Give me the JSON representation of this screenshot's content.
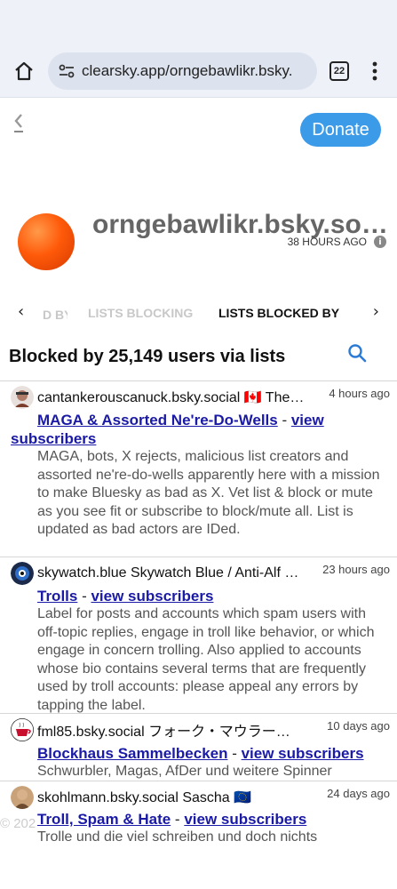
{
  "browser": {
    "url": "clearsky.app/orngebawlikr.bsky.",
    "tab_count": "22"
  },
  "header": {
    "donate_label": "Donate"
  },
  "profile": {
    "handle": "orngebawlikr.bsky.social",
    "joined": "38 HOURS AGO"
  },
  "tabs": {
    "partial_left": "D BY",
    "blocking": "LISTS BLOCKING",
    "blocked_by": "LISTS BLOCKED BY"
  },
  "section": {
    "title": "Blocked by 25,149 users via lists"
  },
  "entries": [
    {
      "name": "cantankerouscanuck.bsky.social 🇨🇦 The…",
      "time": "4 hours ago",
      "list": "MAGA & Assorted Ne're-Do-Wells",
      "sep": " - ",
      "subscribers": "view subscribers",
      "description": "MAGA, bots, X rejects, malicious list creators and assorted ne're-do-wells apparently here with a mission to make Bluesky as bad as X. Vet list & block or mute as you see fit or subscribe to block/mute all. List is updated as bad actors are IDed."
    },
    {
      "name": "skywatch.blue Skywatch Blue / Anti-Alf …",
      "time": "23 hours ago",
      "list": "Trolls",
      "sep": " - ",
      "subscribers": "view subscribers",
      "description": "Label for posts and accounts which spam users with off-topic replies, engage in troll like behavior, or which engage in concern trolling. Also applied to accounts whose bio contains several terms that are frequently used by troll accounts: please appeal any errors by tapping the label."
    },
    {
      "name": "fml85.bsky.social フォーク・マウラー…",
      "time": "10 days ago",
      "list": "Blockhaus Sammelbecken",
      "sep": " - ",
      "subscribers": "view subscribers",
      "description": "Schwurbler, Magas, AfDer und weitere Spinner"
    },
    {
      "name": "skohlmann.bsky.social Sascha 🇪🇺",
      "time": "24 days ago",
      "list": "Troll, Spam & Hate",
      "sep": " - ",
      "subscribers": "view subscribers",
      "description": "Trolle und die viel schreiben und doch nichts"
    }
  ],
  "footer": {
    "copyright": "© 202"
  }
}
